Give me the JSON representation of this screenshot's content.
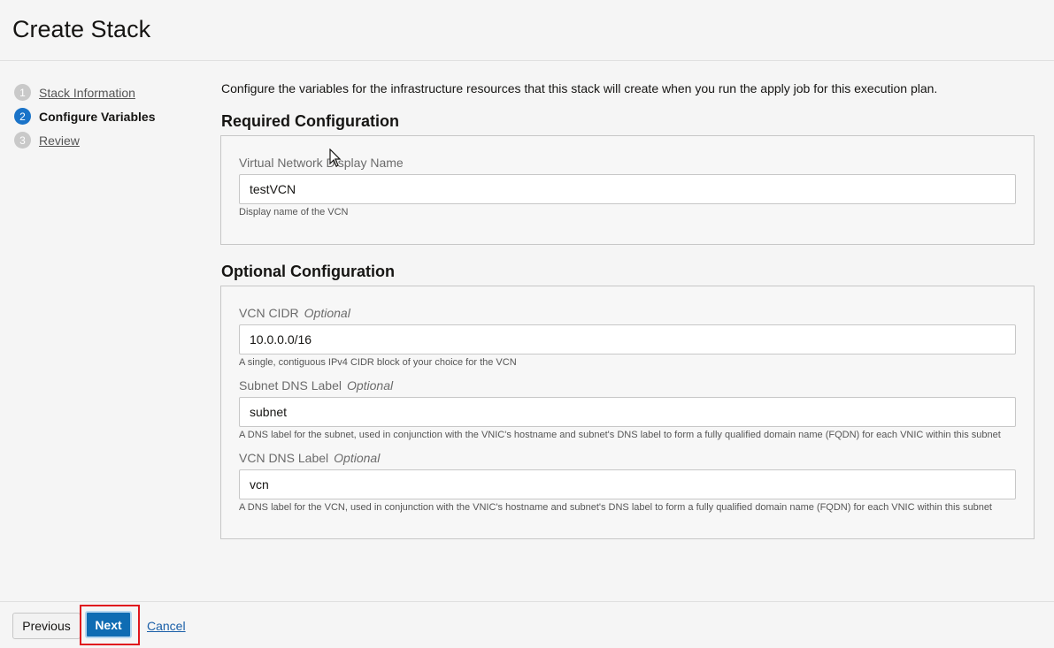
{
  "page": {
    "title": "Create Stack"
  },
  "steps": [
    {
      "num": "1",
      "label": "Stack Information"
    },
    {
      "num": "2",
      "label": "Configure Variables"
    },
    {
      "num": "3",
      "label": "Review"
    }
  ],
  "intro": "Configure the variables for the infrastructure resources that this stack will create when you run the apply job for this execution plan.",
  "required": {
    "title": "Required Configuration",
    "fields": [
      {
        "label": "Virtual Network Display Name",
        "value": "testVCN",
        "help": "Display name of the VCN"
      }
    ]
  },
  "optional": {
    "title": "Optional Configuration",
    "optional_tag": "Optional",
    "fields": [
      {
        "label": "VCN CIDR",
        "value": "10.0.0.0/16",
        "help": "A single, contiguous IPv4 CIDR block of your choice for the VCN"
      },
      {
        "label": "Subnet DNS Label",
        "value": "subnet",
        "help": "A DNS label for the subnet, used in conjunction with the VNIC's hostname and subnet's DNS label to form a fully qualified domain name (FQDN) for each VNIC within this subnet"
      },
      {
        "label": "VCN DNS Label",
        "value": "vcn",
        "help": "A DNS label for the VCN, used in conjunction with the VNIC's hostname and subnet's DNS label to form a fully qualified domain name (FQDN) for each VNIC within this subnet"
      }
    ]
  },
  "footer": {
    "previous": "Previous",
    "next": "Next",
    "cancel": "Cancel"
  },
  "colors": {
    "accent": "#0f6cb3",
    "highlight": "#e0161d",
    "step_active": "#1a73c8"
  }
}
